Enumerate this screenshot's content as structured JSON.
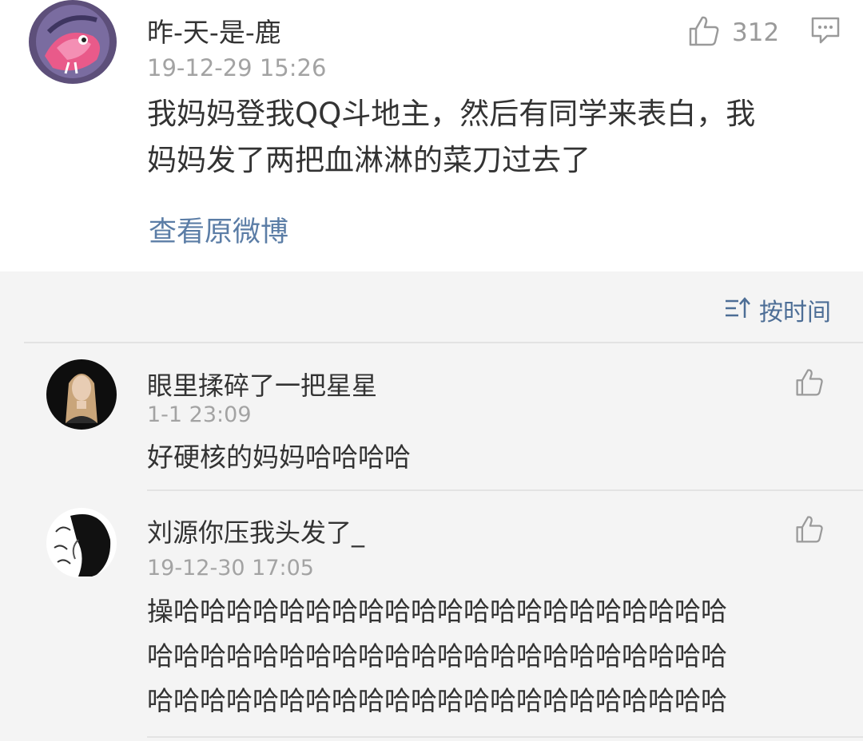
{
  "post": {
    "user": "昨-天-是-鹿",
    "time": "19-12-29 15:26",
    "like_count": "312",
    "like_icon": "thumbs-up-icon",
    "comment_icon": "comment-icon",
    "text_line1": "我妈妈登我QQ斗地主，然后有同学来表白，我",
    "text_line2": "妈妈发了两把血淋淋的菜刀过去了",
    "link": "查看原微博"
  },
  "sort": {
    "icon": "sort-icon",
    "label": "按时间"
  },
  "comments": [
    {
      "user": "眼里揉碎了一把星星",
      "time": "1-1 23:09",
      "lines": [
        "好硬核的妈妈哈哈哈哈"
      ]
    },
    {
      "user": "刘源你压我头发了_",
      "time": "19-12-30 17:05",
      "lines": [
        "操哈哈哈哈哈哈哈哈哈哈哈哈哈哈哈哈哈哈哈哈哈",
        "哈哈哈哈哈哈哈哈哈哈哈哈哈哈哈哈哈哈哈哈哈哈",
        "哈哈哈哈哈哈哈哈哈哈哈哈哈哈哈哈哈哈哈哈哈哈"
      ]
    }
  ],
  "colors": {
    "link": "#5b7da6",
    "sort_label": "#4d6e96",
    "meta_gray": "#a3a3a3",
    "comment_bg": "#f4f4f4"
  }
}
